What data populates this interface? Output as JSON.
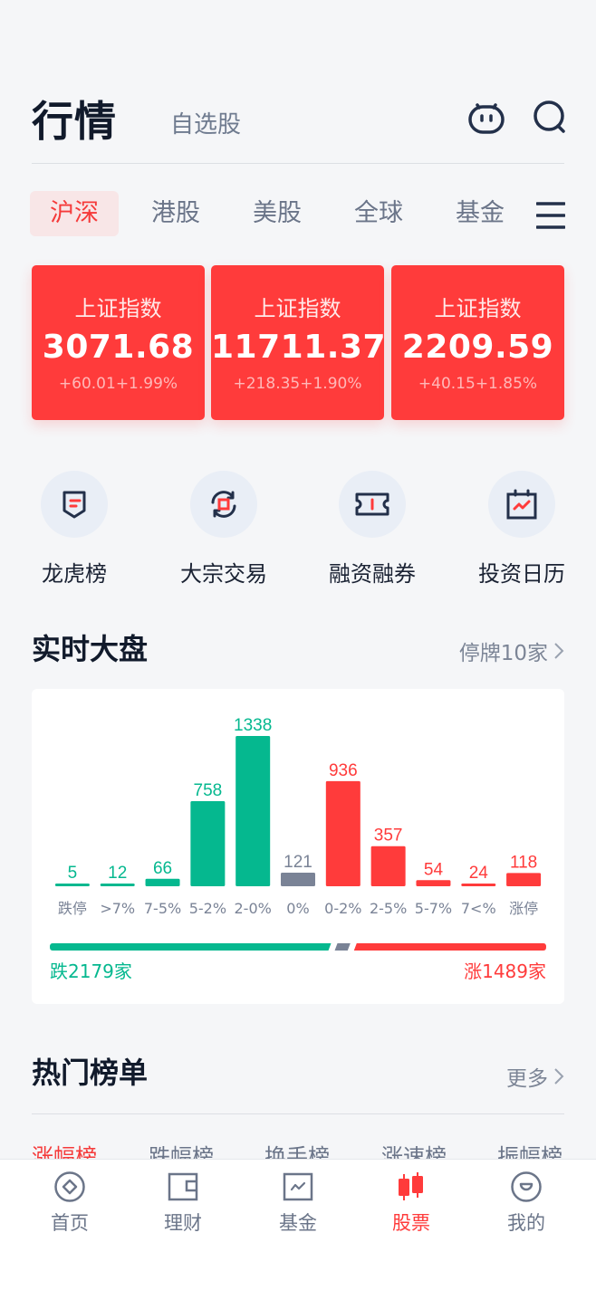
{
  "header": {
    "title": "行情",
    "subtitle": "自选股",
    "icons": [
      "robot-icon",
      "search-icon"
    ]
  },
  "market_tabs": [
    {
      "label": "沪深",
      "active": true
    },
    {
      "label": "港股",
      "active": false
    },
    {
      "label": "美股",
      "active": false
    },
    {
      "label": "全球",
      "active": false
    },
    {
      "label": "基金",
      "active": false
    }
  ],
  "index_cards": [
    {
      "name": "上证指数",
      "value": "3071.68",
      "change": "+60.01+1.99%"
    },
    {
      "name": "上证指数",
      "value": "11711.37",
      "change": "+218.35+1.90%"
    },
    {
      "name": "上证指数",
      "value": "2209.59",
      "change": "+40.15+1.85%"
    }
  ],
  "shortcuts": [
    {
      "label": "龙虎榜",
      "icon": "shield-list-icon"
    },
    {
      "label": "大宗交易",
      "icon": "exchange-icon"
    },
    {
      "label": "融资融券",
      "icon": "ticket-icon"
    },
    {
      "label": "投资日历",
      "icon": "calendar-chart-icon"
    }
  ],
  "market_overview": {
    "title": "实时大盘",
    "link": "停牌10家",
    "down_label": "跌2179家",
    "up_label": "涨1489家",
    "down_count": 2179,
    "flat_count": 121,
    "up_count": 1489
  },
  "chart_data": {
    "type": "bar",
    "title": "实时大盘",
    "xlabel": "",
    "ylabel": "",
    "categories": [
      "跌停",
      ">7%",
      "7-5%",
      "5-2%",
      "2-0%",
      "0%",
      "0-2%",
      "2-5%",
      "5-7%",
      "7<%",
      "涨停"
    ],
    "values": [
      5,
      12,
      66,
      758,
      1338,
      121,
      936,
      357,
      54,
      24,
      118
    ],
    "groups": [
      "down",
      "down",
      "down",
      "down",
      "down",
      "flat",
      "up",
      "up",
      "up",
      "up",
      "up"
    ],
    "ylim": [
      0,
      1338
    ],
    "grid": false,
    "data_labels": true
  },
  "colors": {
    "up": "#ff3b3b",
    "down": "#05b88f",
    "flat": "#7a8396",
    "accent": "#f53a3a"
  },
  "hot_lists": {
    "title": "热门榜单",
    "link": "更多",
    "tabs": [
      {
        "label": "涨幅榜",
        "active": true
      },
      {
        "label": "跌幅榜",
        "active": false
      },
      {
        "label": "换手榜",
        "active": false
      },
      {
        "label": "涨速榜",
        "active": false
      },
      {
        "label": "振幅榜",
        "active": false
      }
    ]
  },
  "bottom_nav": [
    {
      "label": "首页",
      "icon": "home-icon",
      "active": false
    },
    {
      "label": "理财",
      "icon": "wallet-icon",
      "active": false
    },
    {
      "label": "基金",
      "icon": "fund-icon",
      "active": false
    },
    {
      "label": "股票",
      "icon": "stock-candles-icon",
      "active": true
    },
    {
      "label": "我的",
      "icon": "profile-icon",
      "active": false
    }
  ]
}
